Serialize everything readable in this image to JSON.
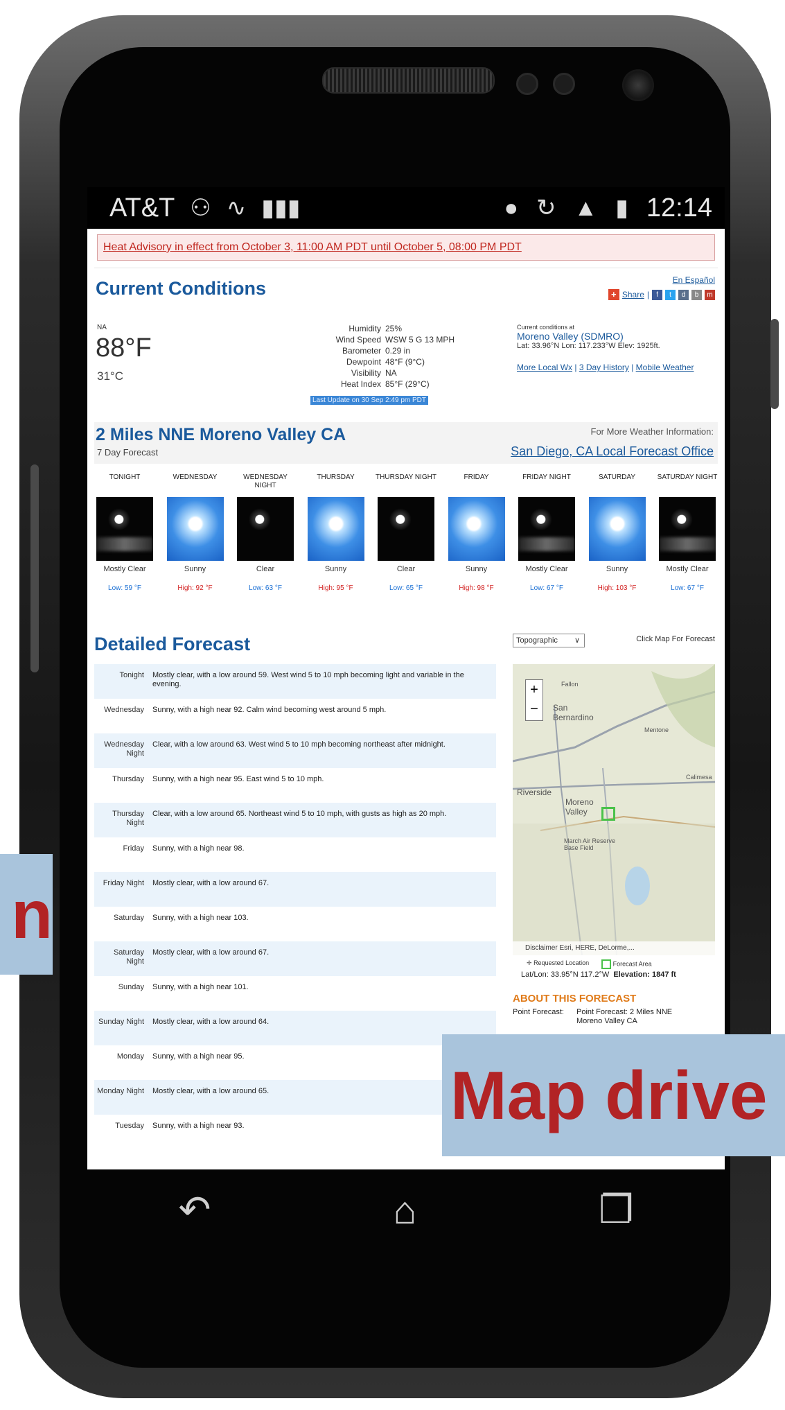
{
  "status_bar": {
    "carrier": "AT&T",
    "time": "12:14"
  },
  "advisory": {
    "text": "Heat Advisory in effect from October 3, 11:00 AM PDT until October 5, 08:00 PM PDT"
  },
  "current_conditions": {
    "title": "Current Conditions",
    "espanol": "En Español",
    "share": "Share",
    "na": "NA",
    "temp_f": "88°F",
    "temp_c": "31°C",
    "details": [
      {
        "label": "Humidity",
        "value": "25%"
      },
      {
        "label": "Wind Speed",
        "value": "WSW 5 G 13 MPH"
      },
      {
        "label": "Barometer",
        "value": "0.29 in"
      },
      {
        "label": "Dewpoint",
        "value": "48°F (9°C)"
      },
      {
        "label": "Visibility",
        "value": "NA"
      },
      {
        "label": "Heat Index",
        "value": "85°F (29°C)"
      }
    ],
    "last_update": "Last Update on 30 Sep 2:49 pm PDT",
    "station_heading": "Current conditions at",
    "station_name": "Moreno Valley (SDMRO)",
    "station_coords": "Lat: 33.96°N Lon: 117.233°W Elev: 1925ft.",
    "links": [
      "More Local Wx",
      "3 Day History",
      "Mobile Weather"
    ]
  },
  "forecast_header": {
    "location": "2 Miles NNE Moreno Valley CA",
    "subtitle": "7 Day Forecast",
    "more_info": "For More Weather Information:",
    "office": "San Diego, CA Local Forecast Office"
  },
  "periods": [
    {
      "name": "TONIGHT",
      "short": "Mostly Clear",
      "temp": "Low: 59 °F",
      "kind": "low",
      "icon": "night-icon"
    },
    {
      "name": "WEDNESDAY",
      "short": "Sunny",
      "temp": "High: 92 °F",
      "kind": "high",
      "icon": "sun-icon"
    },
    {
      "name": "WEDNESDAY NIGHT",
      "short": "Clear",
      "temp": "Low: 63 °F",
      "kind": "low",
      "icon": "night-icon"
    },
    {
      "name": "THURSDAY",
      "short": "Sunny",
      "temp": "High: 95 °F",
      "kind": "high",
      "icon": "sun-icon"
    },
    {
      "name": "THURSDAY NIGHT",
      "short": "Clear",
      "temp": "Low: 65 °F",
      "kind": "low",
      "icon": "night-icon"
    },
    {
      "name": "FRIDAY",
      "short": "Sunny",
      "temp": "High: 98 °F",
      "kind": "high",
      "icon": "sun-icon"
    },
    {
      "name": "FRIDAY NIGHT",
      "short": "Mostly Clear",
      "temp": "Low: 67 °F",
      "kind": "low",
      "icon": "night-icon"
    },
    {
      "name": "SATURDAY",
      "short": "Sunny",
      "temp": "High: 103 °F",
      "kind": "high",
      "icon": "sun-icon"
    },
    {
      "name": "SATURDAY NIGHT",
      "short": "Mostly Clear",
      "temp": "Low: 67 °F",
      "kind": "low",
      "icon": "night-icon"
    }
  ],
  "detailed_forecast": {
    "title": "Detailed Forecast",
    "rows": [
      {
        "label": "Tonight",
        "text": "Mostly clear, with a low around 59. West wind 5 to 10 mph becoming light and variable in the evening."
      },
      {
        "label": "Wednesday",
        "text": "Sunny, with a high near 92. Calm wind becoming west around 5 mph."
      },
      {
        "label": "Wednesday Night",
        "text": "Clear, with a low around 63. West wind 5 to 10 mph becoming northeast after midnight."
      },
      {
        "label": "Thursday",
        "text": "Sunny, with a high near 95. East wind 5 to 10 mph."
      },
      {
        "label": "Thursday Night",
        "text": "Clear, with a low around 65. Northeast wind 5 to 10 mph, with gusts as high as 20 mph."
      },
      {
        "label": "Friday",
        "text": "Sunny, with a high near 98."
      },
      {
        "label": "Friday Night",
        "text": "Mostly clear, with a low around 67."
      },
      {
        "label": "Saturday",
        "text": "Sunny, with a high near 103."
      },
      {
        "label": "Saturday Night",
        "text": "Mostly clear, with a low around 67."
      },
      {
        "label": "Sunday",
        "text": "Sunny, with a high near 101."
      },
      {
        "label": "Sunday Night",
        "text": "Mostly clear, with a low around 64."
      },
      {
        "label": "Monday",
        "text": "Sunny, with a high near 95."
      },
      {
        "label": "Monday Night",
        "text": "Mostly clear, with a low around 65."
      },
      {
        "label": "Tuesday",
        "text": "Sunny, with a high near 93."
      }
    ]
  },
  "map": {
    "select_value": "Topographic",
    "click_hint": "Click Map For Forecast",
    "labels": [
      "Fallon",
      "San Bernardino",
      "Mentone",
      "Riverside",
      "Moreno Valley",
      "March Air Reserve Base Field",
      "Calimesa"
    ],
    "attribution": "Disclaimer  Esri, HERE, DeLorme,...",
    "legend_requested": "Requested Location",
    "legend_area": "Forecast Area",
    "latlon": "Lat/Lon: 33.95°N 117.2°W",
    "elevation": "Elevation: 1847 ft"
  },
  "about": {
    "title": "ABOUT THIS FORECAST",
    "label": "Point Forecast:",
    "value": "Point Forecast: 2 Miles NNE Moreno Valley CA"
  },
  "overlays": {
    "left_text": "n",
    "right_text": "Map drive"
  },
  "colors": {
    "accent": "#1b5a9c",
    "advisory": "#c0271f",
    "overlay_bg": "#a9c4dc",
    "overlay_text": "#b22325"
  }
}
